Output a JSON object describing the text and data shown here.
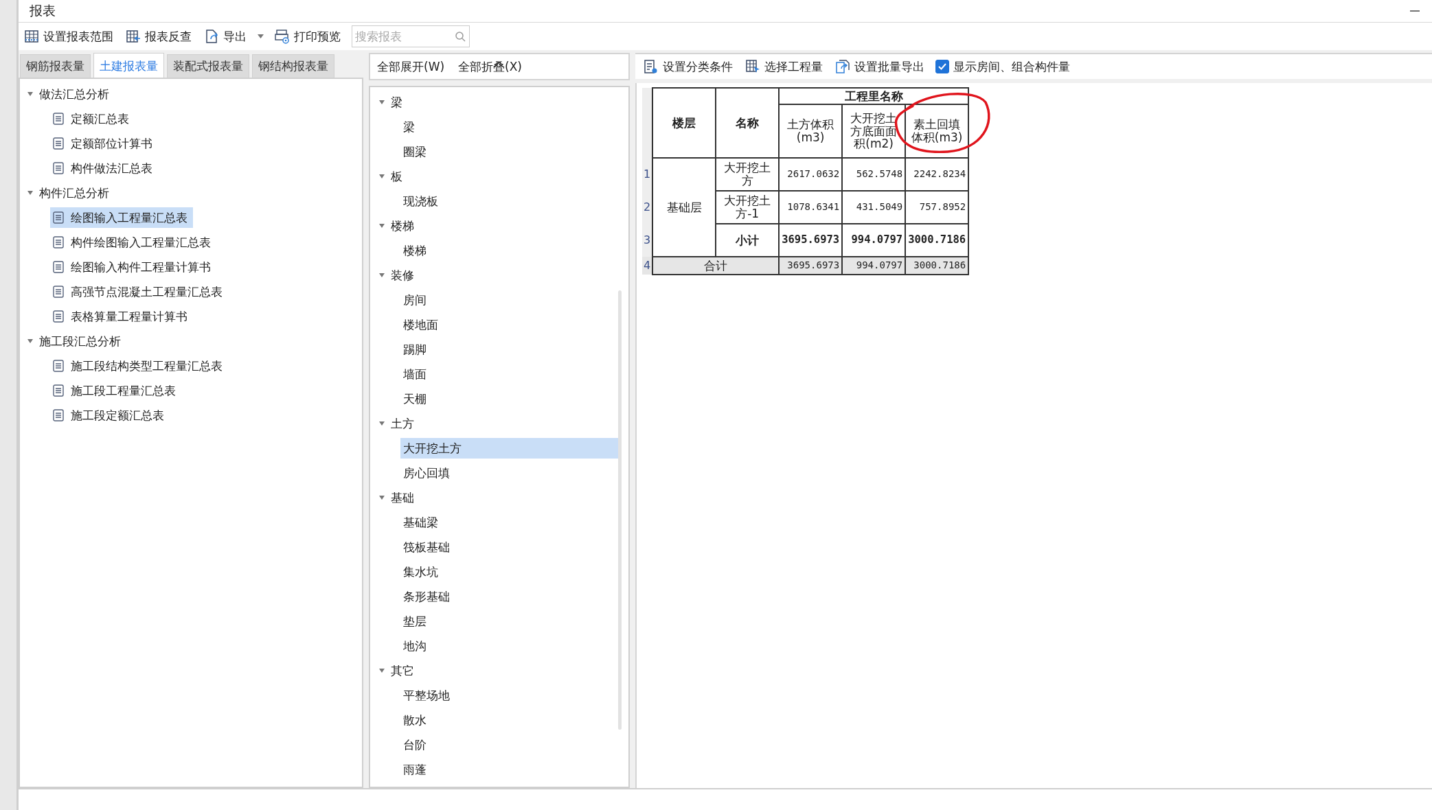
{
  "window": {
    "title": "报表"
  },
  "toolbar": {
    "buttons": [
      {
        "label": "设置报表范围"
      },
      {
        "label": "报表反查"
      },
      {
        "label": "导出",
        "dropdown": true
      },
      {
        "label": "打印预览"
      }
    ],
    "search": {
      "placeholder": "搜索报表"
    }
  },
  "tabs": [
    {
      "label": "钢筋报表量",
      "selected": false
    },
    {
      "label": "土建报表量",
      "selected": true
    },
    {
      "label": "装配式报表量",
      "selected": false
    },
    {
      "label": "钢结构报表量",
      "selected": false
    }
  ],
  "report_tree": [
    {
      "label": "做法汇总分析",
      "expanded": true,
      "children": [
        {
          "label": "定额汇总表",
          "selected": false
        },
        {
          "label": "定额部位计算书",
          "selected": false
        },
        {
          "label": "构件做法汇总表",
          "selected": false
        }
      ]
    },
    {
      "label": "构件汇总分析",
      "expanded": true,
      "children": [
        {
          "label": "绘图输入工程量汇总表",
          "selected": true
        },
        {
          "label": "构件绘图输入工程量汇总表",
          "selected": false
        },
        {
          "label": "绘图输入构件工程量计算书",
          "selected": false
        },
        {
          "label": "高强节点混凝土工程量汇总表",
          "selected": false
        },
        {
          "label": "表格算量工程量计算书",
          "selected": false
        }
      ]
    },
    {
      "label": "施工段汇总分析",
      "expanded": true,
      "children": [
        {
          "label": "施工段结构类型工程量汇总表",
          "selected": false
        },
        {
          "label": "施工段工程量汇总表",
          "selected": false
        },
        {
          "label": "施工段定额汇总表",
          "selected": false
        }
      ]
    }
  ],
  "component_panel": {
    "expand_all": "全部展开(W)",
    "collapse_all": "全部折叠(X)",
    "tree": [
      {
        "label": "梁",
        "expanded": true,
        "children": [
          {
            "label": "梁",
            "selected": false
          },
          {
            "label": "圈梁",
            "selected": false
          }
        ]
      },
      {
        "label": "板",
        "expanded": true,
        "children": [
          {
            "label": "现浇板",
            "selected": false
          }
        ]
      },
      {
        "label": "楼梯",
        "expanded": true,
        "children": [
          {
            "label": "楼梯",
            "selected": false
          }
        ]
      },
      {
        "label": "装修",
        "expanded": true,
        "children": [
          {
            "label": "房间",
            "selected": false
          },
          {
            "label": "楼地面",
            "selected": false
          },
          {
            "label": "踢脚",
            "selected": false
          },
          {
            "label": "墙面",
            "selected": false
          },
          {
            "label": "天棚",
            "selected": false
          }
        ]
      },
      {
        "label": "土方",
        "expanded": true,
        "children": [
          {
            "label": "大开挖土方",
            "selected": true
          },
          {
            "label": "房心回填",
            "selected": false
          }
        ]
      },
      {
        "label": "基础",
        "expanded": true,
        "children": [
          {
            "label": "基础梁",
            "selected": false
          },
          {
            "label": "筏板基础",
            "selected": false
          },
          {
            "label": "集水坑",
            "selected": false
          },
          {
            "label": "条形基础",
            "selected": false
          },
          {
            "label": "垫层",
            "selected": false
          },
          {
            "label": "地沟",
            "selected": false
          }
        ]
      },
      {
        "label": "其它",
        "expanded": true,
        "children": [
          {
            "label": "平整场地",
            "selected": false
          },
          {
            "label": "散水",
            "selected": false
          },
          {
            "label": "台阶",
            "selected": false
          },
          {
            "label": "雨蓬",
            "selected": false
          }
        ]
      }
    ]
  },
  "report_toolbar": {
    "buttons": [
      {
        "label": "设置分类条件"
      },
      {
        "label": "选择工程量"
      },
      {
        "label": "设置批量导出"
      }
    ],
    "checkbox": {
      "label": "显示房间、组合构件量",
      "checked": true
    }
  },
  "table": {
    "floor_header": "楼层",
    "name_header": "名称",
    "group_header": "工程里名称",
    "columns": [
      "土方体积(m3)",
      "大开挖土方底面面积(m2)",
      "素土回填体积(m3)"
    ],
    "floor": "基础层",
    "rows": [
      {
        "row_number": "1",
        "name": "大开挖土方",
        "kind": "item",
        "values": [
          "2617.0632",
          "562.5748",
          "2242.8234"
        ]
      },
      {
        "row_number": "2",
        "name": "大开挖土方-1",
        "kind": "item",
        "values": [
          "1078.6341",
          "431.5049",
          "757.8952"
        ]
      },
      {
        "row_number": "3",
        "name": "小计",
        "kind": "subtotal",
        "values": [
          "3695.6973",
          "994.0797",
          "3000.7186"
        ]
      }
    ],
    "total": {
      "row_number": "4",
      "label": "合计",
      "values": [
        "3695.6973",
        "994.0797",
        "3000.7186"
      ]
    }
  }
}
